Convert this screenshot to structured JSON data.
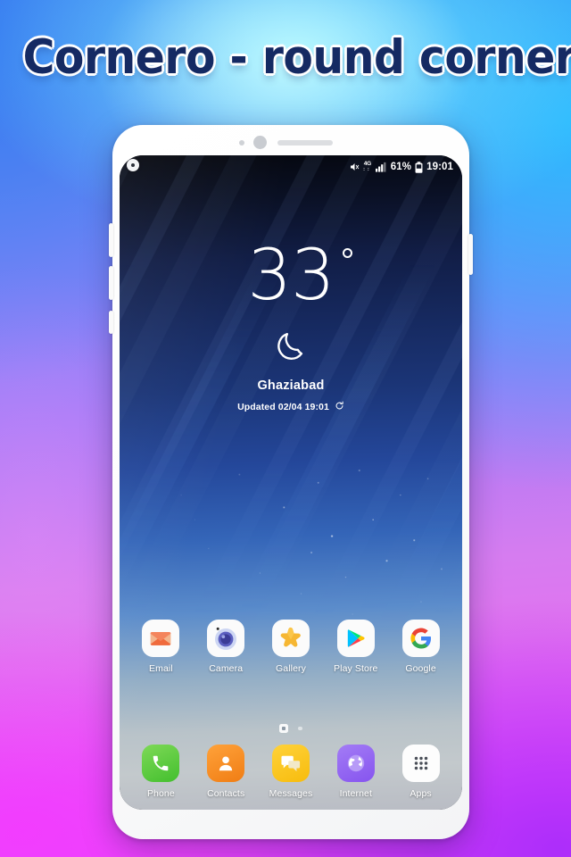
{
  "page": {
    "title": "Cornero - round corner",
    "accent_blue": "#3f86ef",
    "accent_magenta": "#ef48fb",
    "title_color": "#152a63"
  },
  "phone": {
    "hardware": {
      "sensor": "proximity-sensor",
      "front_camera": "front-camera",
      "earpiece": "earpiece-speaker",
      "volume_up": "volume-up-button",
      "volume_down": "volume-down-button",
      "bixby": "bixby-button",
      "power": "power-button"
    },
    "status_bar": {
      "mute_icon": "mute-icon",
      "network_label": "4G",
      "network_sub": "::",
      "signal_icon": "signal-bars-icon",
      "battery_percent": "61%",
      "battery_icon": "battery-icon",
      "clock": "19:01"
    },
    "overlay_button": "floating-overlay-button",
    "weather": {
      "temperature": "33",
      "degree_symbol": "°",
      "condition_icon": "moon-icon",
      "city": "Ghaziabad",
      "updated_label": "Updated 02/04 19:01",
      "refresh_icon": "refresh-icon"
    },
    "apps": [
      {
        "label": "Email",
        "icon": "email-icon"
      },
      {
        "label": "Camera",
        "icon": "camera-icon"
      },
      {
        "label": "Gallery",
        "icon": "gallery-icon"
      },
      {
        "label": "Play Store",
        "icon": "play-store-icon"
      },
      {
        "label": "Google",
        "icon": "google-icon"
      }
    ],
    "page_indicator": {
      "home_icon": "home-screen-icon",
      "pages": 2,
      "current": 1
    },
    "dock": [
      {
        "label": "Phone",
        "icon": "phone-icon"
      },
      {
        "label": "Contacts",
        "icon": "contacts-icon"
      },
      {
        "label": "Messages",
        "icon": "messages-icon"
      },
      {
        "label": "Internet",
        "icon": "internet-icon"
      },
      {
        "label": "Apps",
        "icon": "apps-grid-icon"
      }
    ]
  }
}
